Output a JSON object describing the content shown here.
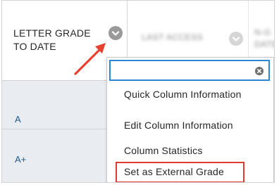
{
  "table": {
    "header": {
      "letter_grade_column": "LETTER GRADE TO DATE",
      "letter_grade_line1": "LETTER GRADE",
      "letter_grade_line2": "TO DATE",
      "last_access_column": "LAST ACCESS",
      "next_column_line1": "N-G",
      "next_column_line2": "DATE"
    },
    "rows": [
      {
        "letter_grade": "A"
      },
      {
        "letter_grade": "A+"
      }
    ]
  },
  "column_menu": {
    "search": {
      "value": ""
    },
    "items": [
      {
        "label": "Quick Column Information"
      },
      {
        "label": "Edit Column Information"
      },
      {
        "label": "Column Statistics"
      },
      {
        "label": "Set as External Grade"
      }
    ]
  },
  "annotation": {
    "highlight_color": "#e23b2e",
    "accent": "#2a86d6",
    "grade_text_color": "#1e5b8e"
  }
}
